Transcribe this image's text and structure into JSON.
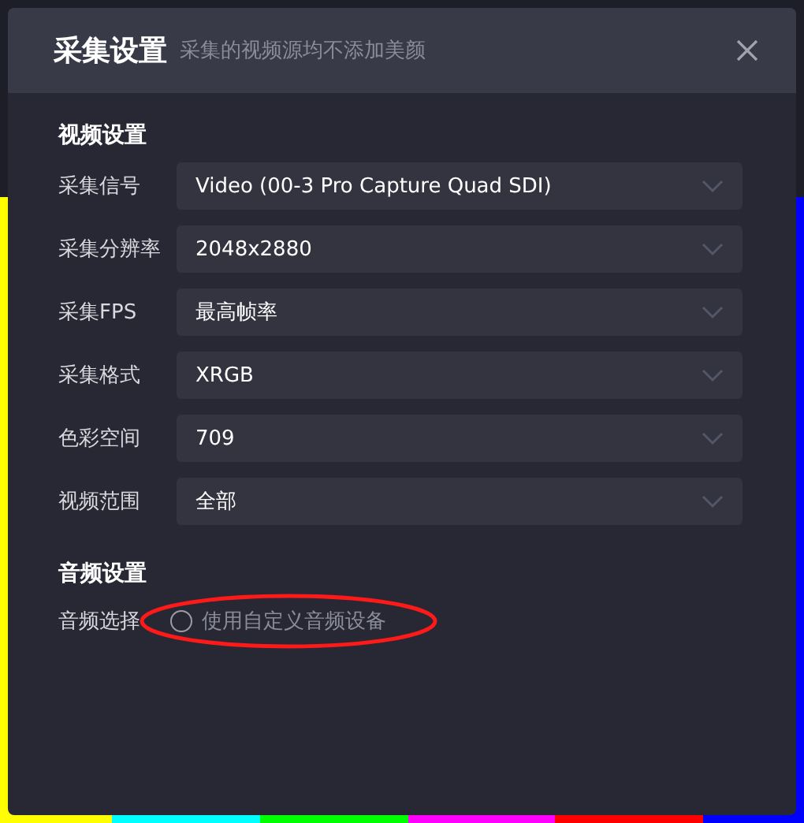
{
  "dialog": {
    "title": "采集设置",
    "subtitle": "采集的视频源均不添加美颜"
  },
  "video_section": {
    "heading": "视频设置",
    "fields": [
      {
        "label": "采集信号",
        "value": "Video (00-3 Pro Capture Quad SDI)"
      },
      {
        "label": "采集分辨率",
        "value": "2048x2880"
      },
      {
        "label": "采集FPS",
        "value": "最高帧率"
      },
      {
        "label": "采集格式",
        "value": "XRGB"
      },
      {
        "label": "色彩空间",
        "value": "709"
      },
      {
        "label": "视频范围",
        "value": "全部"
      }
    ]
  },
  "audio_section": {
    "heading": "音频设置",
    "label": "音频选择",
    "option": {
      "label": "使用自定义音频设备",
      "selected": false
    }
  }
}
